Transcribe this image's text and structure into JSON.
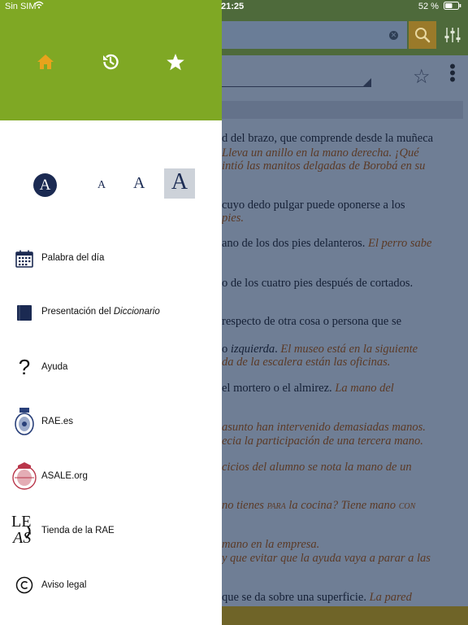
{
  "status_bar": {
    "carrier": "Sin SIM",
    "time": "21:25",
    "battery": "52 %"
  },
  "font_size": {
    "sample_glyph": "A",
    "small": "A",
    "medium": "A",
    "large": "A",
    "selected": "large"
  },
  "menu": [
    {
      "label": "Palabra del día",
      "icon": "calendar-icon"
    },
    {
      "label_prefix": "Presentación del ",
      "label_em": "Diccionario",
      "icon": "book-icon"
    },
    {
      "label": "Ayuda",
      "icon": "question-icon"
    },
    {
      "label": "RAE.es",
      "icon": "rae-seal-icon"
    },
    {
      "label": "ASALE.org",
      "icon": "asale-seal-icon"
    },
    {
      "label": "Tienda de la RAE",
      "icon": "letras-logo-icon"
    },
    {
      "label": "Aviso legal",
      "icon": "copyright-icon"
    }
  ],
  "definition_lines": [
    {
      "plain": "d del brazo, que comprende desde la muñeca"
    },
    {
      "em": "Lleva un anillo en la mano derecha. ¡Qué"
    },
    {
      "em": "intió las manitos delgadas de Borobá en su"
    },
    {
      "plain": "cuyo dedo pulgar puede oponerse a los"
    },
    {
      "em": "pies."
    },
    {
      "plain": "ano de los dos pies delanteros. ",
      "em": "El perro sabe"
    },
    {
      "plain": "o de los cuatro pies después de cortados."
    },
    {
      "plain": "respecto de otra cosa o persona que se"
    },
    {
      "plain": "o ",
      "plain_em": "izquierda",
      "plain2": ". ",
      "em": "El museo está en la siguiente"
    },
    {
      "em": "da de la escalera están las oficinas."
    },
    {
      "plain": "el mortero o el almirez. ",
      "em": "La mano del"
    },
    {
      "em": "asunto han intervenido demasiadas manos."
    },
    {
      "em": "ecia la participación de una tercera mano."
    },
    {
      "em": "cicios del alumno se nota la mano de un"
    },
    {
      "em": "no tienes ",
      "sc": "para",
      "em2": " la cocina? Tiene mano ",
      "sc2": "con"
    },
    {
      "em": "mano en la empresa."
    },
    {
      "em": "y que evitar que la ayuda vaya a parar a las"
    },
    {
      "plain": "que se da sobre una superficie. ",
      "em": "La pared"
    }
  ]
}
